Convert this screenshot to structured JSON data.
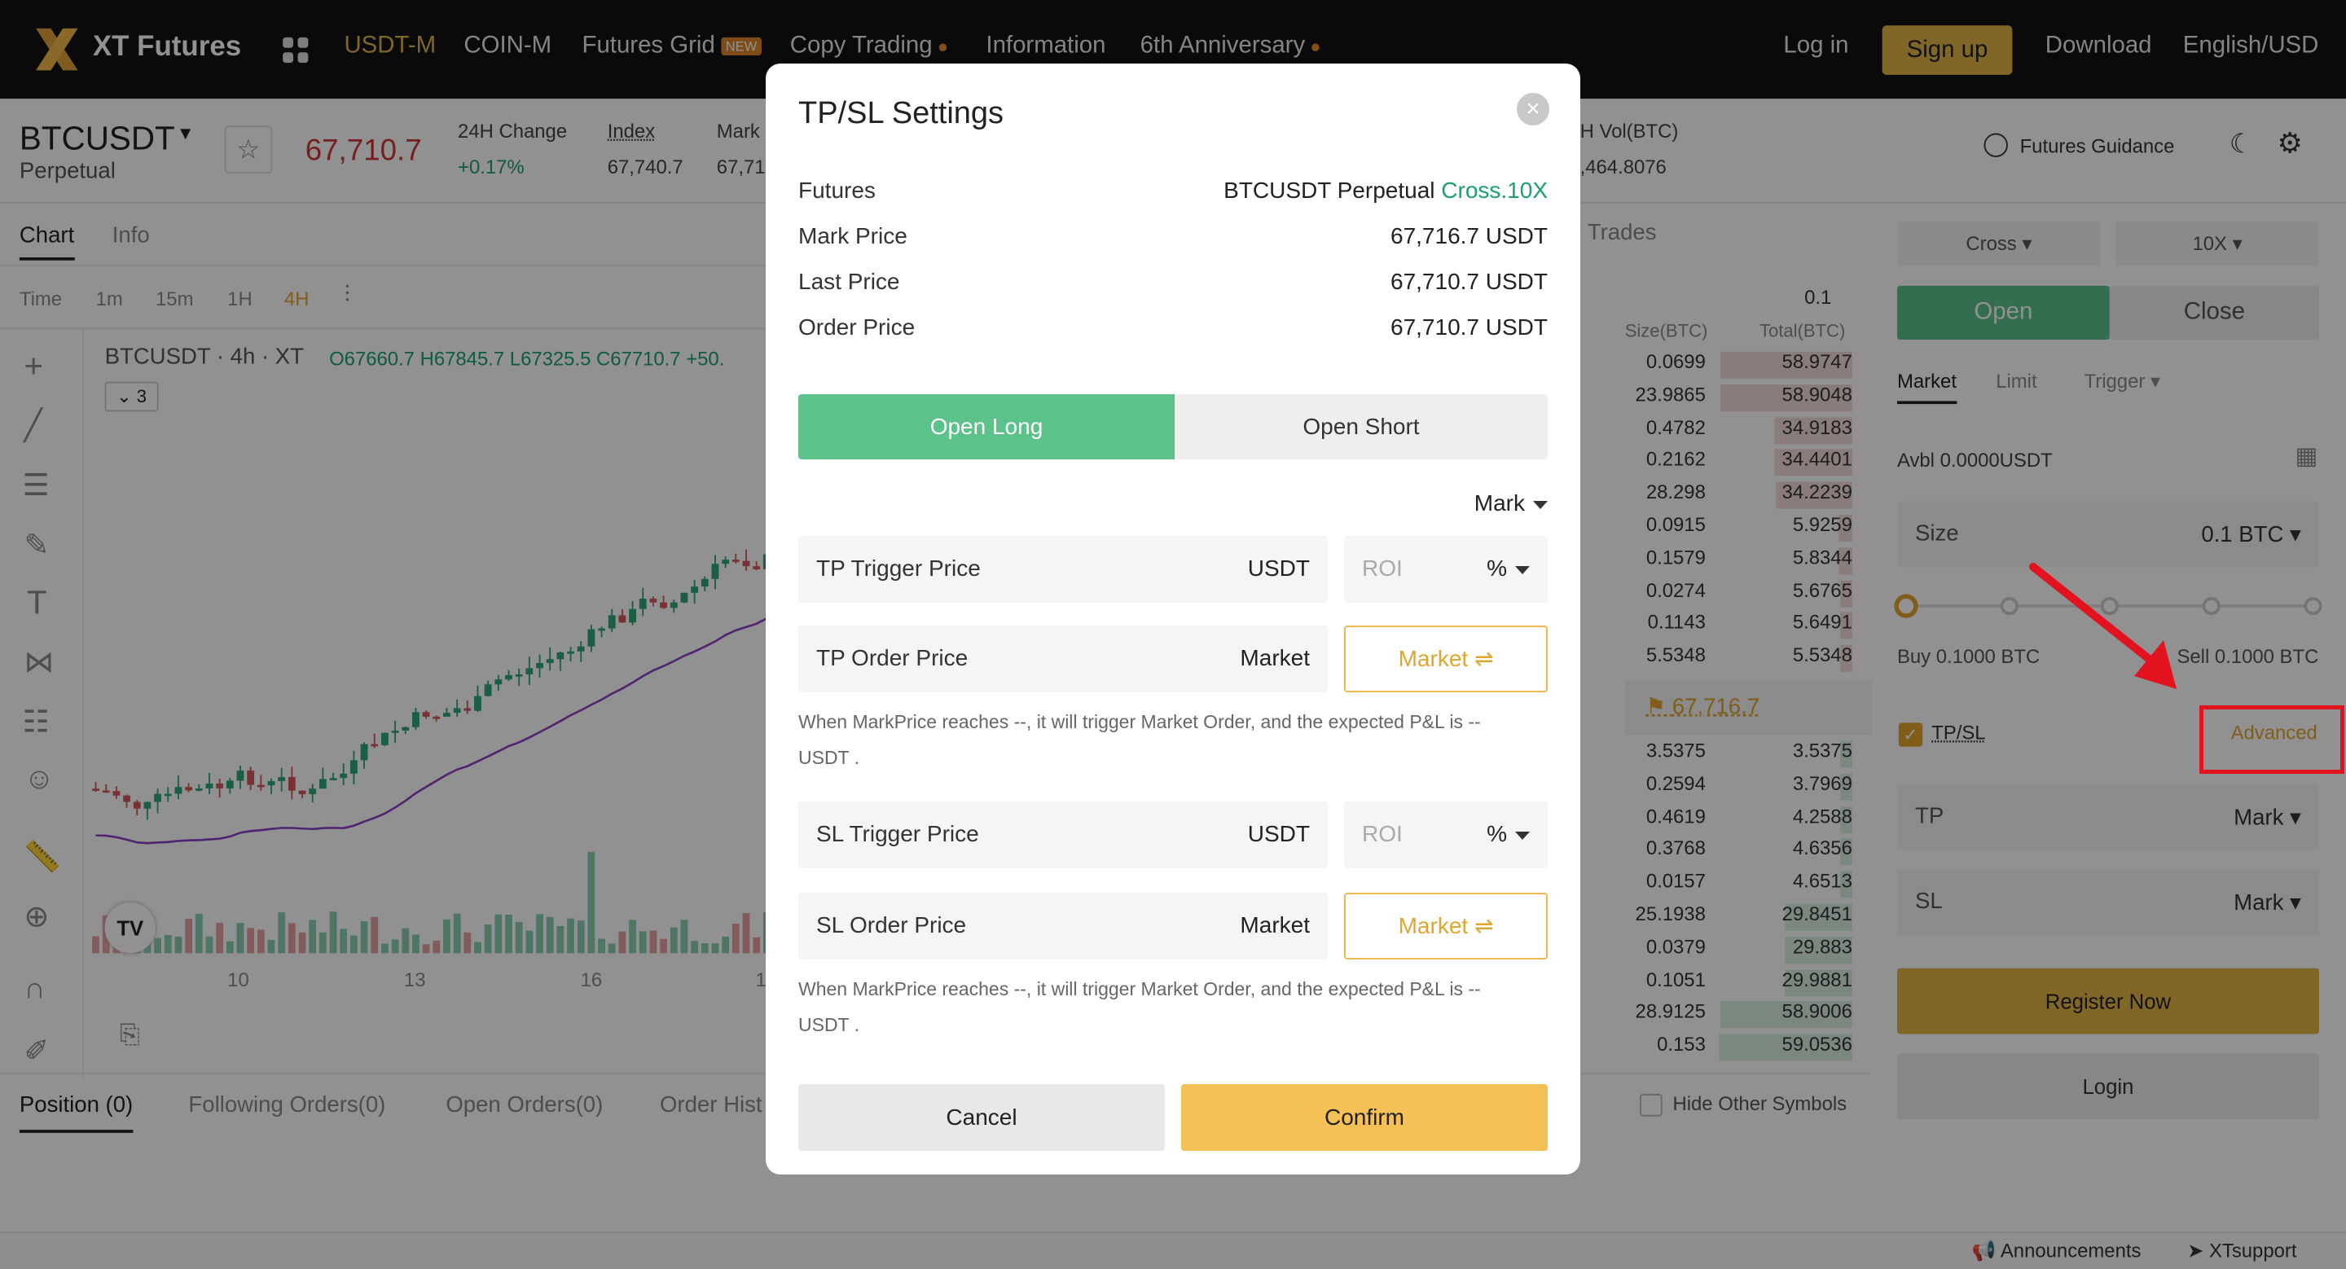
{
  "nav": {
    "brand": "XT Futures",
    "items": [
      "USDT-M",
      "COIN-M",
      "Futures Grid",
      "Copy Trading",
      "Information",
      "6th Anniversary"
    ],
    "new_badge": "NEW",
    "login": "Log in",
    "signup": "Sign up",
    "download": "Download",
    "language": "English/USD"
  },
  "ticker": {
    "symbol": "BTCUSDT",
    "sub": "Perpetual",
    "price": "67,710.7",
    "change_label": "24H Change",
    "change_value": "+0.17%",
    "index_label": "Index",
    "index_value": "67,740.7",
    "mark_label": "Mark",
    "mark_value": "67,71",
    "vol_label": "H Vol(BTC)",
    "vol_value": ",464.8076",
    "guidance": "Futures Guidance"
  },
  "chart": {
    "tabs": [
      "Chart",
      "Info"
    ],
    "intervals": [
      "Time",
      "1m",
      "15m",
      "1H",
      "4H"
    ],
    "legend": "BTCUSDT · 4h · XT",
    "ohlc": "O67660.7 H67845.7 L67325.5 C67710.7 +50.",
    "collapse_count": "3",
    "xaxis": [
      "10",
      "13",
      "16",
      "1"
    ]
  },
  "orderbook": {
    "trades_label": "Trades",
    "precision": "0.1",
    "col_size": "Size(BTC)",
    "col_total": "Total(BTC)",
    "asks": [
      [
        "0.0699",
        "58.9747"
      ],
      [
        "23.9865",
        "58.9048"
      ],
      [
        "0.4782",
        "34.9183"
      ],
      [
        "0.2162",
        "34.4401"
      ],
      [
        "28.298",
        "34.2239"
      ],
      [
        "0.0915",
        "5.9259"
      ],
      [
        "0.1579",
        "5.8344"
      ],
      [
        "0.0274",
        "5.6765"
      ],
      [
        "0.1143",
        "5.6491"
      ],
      [
        "5.5348",
        "5.5348"
      ]
    ],
    "mid_price": "67,716.7",
    "bids": [
      [
        "3.5375",
        "3.5375"
      ],
      [
        "0.2594",
        "3.7969"
      ],
      [
        "0.4619",
        "4.2588"
      ],
      [
        "0.3768",
        "4.6356"
      ],
      [
        "0.0157",
        "4.6513"
      ],
      [
        "25.1938",
        "29.8451"
      ],
      [
        "0.0379",
        "29.883"
      ],
      [
        "0.1051",
        "29.9881"
      ],
      [
        "28.9125",
        "58.9006"
      ],
      [
        "0.153",
        "59.0536"
      ]
    ],
    "hide_other": "Hide Other Symbols"
  },
  "bottom_tabs": [
    "Position (0)",
    "Following Orders(0)",
    "Open Orders(0)",
    "Order Hist"
  ],
  "trade_panel": {
    "margin_mode": "Cross",
    "leverage": "10X",
    "open": "Open",
    "close": "Close",
    "order_types": [
      "Market",
      "Limit",
      "Trigger"
    ],
    "avbl": "Avbl 0.0000USDT",
    "size_label": "Size",
    "size_value": "0.1 BTC",
    "buy": "Buy 0.1000 BTC",
    "sell": "Sell 0.1000 BTC",
    "tpsl": "TP/SL",
    "advanced": "Advanced",
    "tp": "TP",
    "sl": "SL",
    "mark": "Mark",
    "register": "Register Now",
    "login": "Login"
  },
  "footer": {
    "announcements": "Announcements",
    "support": "XTsupport"
  },
  "modal": {
    "title": "TP/SL Settings",
    "rows": [
      {
        "k": "Futures",
        "v": "BTCUSDT Perpetual ",
        "v_accent": "Cross.10X"
      },
      {
        "k": "Mark Price",
        "v": "67,716.7 USDT"
      },
      {
        "k": "Last Price",
        "v": "67,710.7 USDT"
      },
      {
        "k": "Order Price",
        "v": "67,710.7 USDT"
      }
    ],
    "tab_long": "Open Long",
    "tab_short": "Open Short",
    "trigger_type": "Mark",
    "tp_trigger_label": "TP Trigger Price",
    "tp_order_label": "TP Order Price",
    "sl_trigger_label": "SL Trigger Price",
    "sl_order_label": "SL Order Price",
    "unit_usdt": "USDT",
    "unit_market": "Market",
    "roi": "ROI",
    "pct": "%",
    "market_btn": "Market ⇌",
    "hint_line1": "When MarkPrice reaches --, it will trigger Market Order, and the expected P&L is --",
    "hint_line2": "USDT .",
    "cancel": "Cancel",
    "confirm": "Confirm"
  },
  "colors": {
    "accent_green": "#5bc28a",
    "accent_gold": "#f5c156",
    "annotation_red": "#e3121f"
  }
}
